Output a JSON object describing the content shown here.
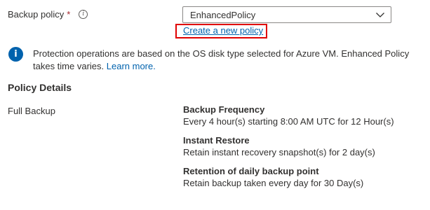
{
  "backup_policy": {
    "label": "Backup policy",
    "required_marker": "*",
    "info_icon": "info-outline-icon",
    "selected_value": "EnhancedPolicy",
    "dropdown_icon": "chevron-down-icon",
    "create_link": "Create a new policy"
  },
  "info_banner": {
    "icon": "info-filled-icon",
    "text": "Protection operations are based on the OS disk type selected for Azure VM. Enhanced Policy takes time varies. ",
    "link": "Learn more."
  },
  "policy_details": {
    "heading": "Policy Details",
    "row_label": "Full Backup",
    "items": [
      {
        "title": "Backup Frequency",
        "text": "Every 4 hour(s) starting 8:00 AM UTC for 12 Hour(s)"
      },
      {
        "title": "Instant Restore",
        "text": "Retain instant recovery snapshot(s) for 2 day(s)"
      },
      {
        "title": "Retention of daily backup point",
        "text": "Retain backup taken every day for 30 Day(s)"
      }
    ]
  },
  "colors": {
    "link": "#0062ad",
    "required": "#a4262c",
    "highlight": "#e00000",
    "text": "#323130"
  }
}
